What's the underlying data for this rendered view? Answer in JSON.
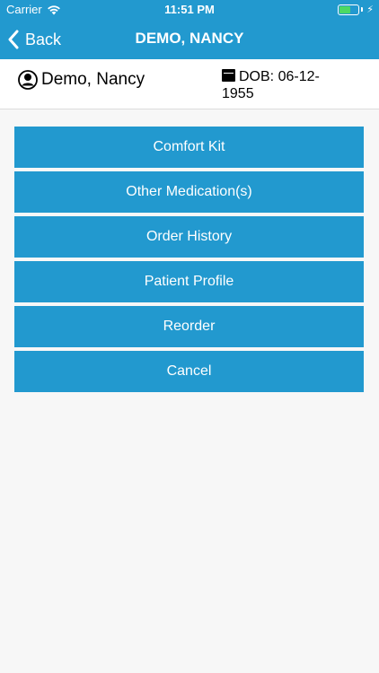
{
  "status_bar": {
    "carrier": "Carrier",
    "time": "11:51 PM",
    "battery_level": 0.6,
    "battery_color": "#4cd964"
  },
  "nav": {
    "back_label": "Back",
    "title": "DEMO, NANCY",
    "bar_color": "#2299cf"
  },
  "patient": {
    "name": "Demo, Nancy",
    "dob_line1": "DOB: 06-12-",
    "dob_line2": "1955",
    "name_icon": "person-icon",
    "dob_icon": "calendar-icon"
  },
  "menu": {
    "button_color": "#2299cf",
    "items": [
      {
        "label": "Comfort Kit"
      },
      {
        "label": "Other Medication(s)"
      },
      {
        "label": "Order History"
      },
      {
        "label": "Patient Profile"
      },
      {
        "label": "Reorder"
      },
      {
        "label": "Cancel"
      }
    ]
  }
}
